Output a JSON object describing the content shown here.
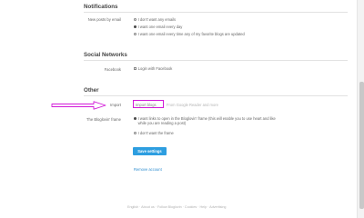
{
  "notifications": {
    "title": "Notifications",
    "new_posts_label": "New posts by email",
    "options": [
      "I don't want any emails",
      "I want one email every day",
      "I want one email every time any of my favorite blogs are updated"
    ],
    "selected_index": 1
  },
  "social_networks": {
    "title": "Social Networks",
    "facebook_label": "Facebook",
    "facebook_option": "Login with Facebook"
  },
  "other": {
    "title": "Other",
    "import_label": "Import",
    "import_button": "Import blogs",
    "import_hint": "From Google Reader and more",
    "bloglovin_frame_label": "The Bloglovin' frame",
    "frame_options": [
      "I want links to open in the Bloglovin' frame (this will enable you to use heart and like while you are reading a post)",
      "I don't want the frame"
    ],
    "frame_selected_index": 0
  },
  "actions": {
    "save_button": "Save settings",
    "remove_link": "Remove account"
  },
  "footer": {
    "links_text": "English · About us · Follow Bloglovin · Cookies · Help · Advertising"
  },
  "colors": {
    "highlight": "#d21ad8",
    "primary_button": "#2d9ee0",
    "link": "#2d8dd0"
  }
}
